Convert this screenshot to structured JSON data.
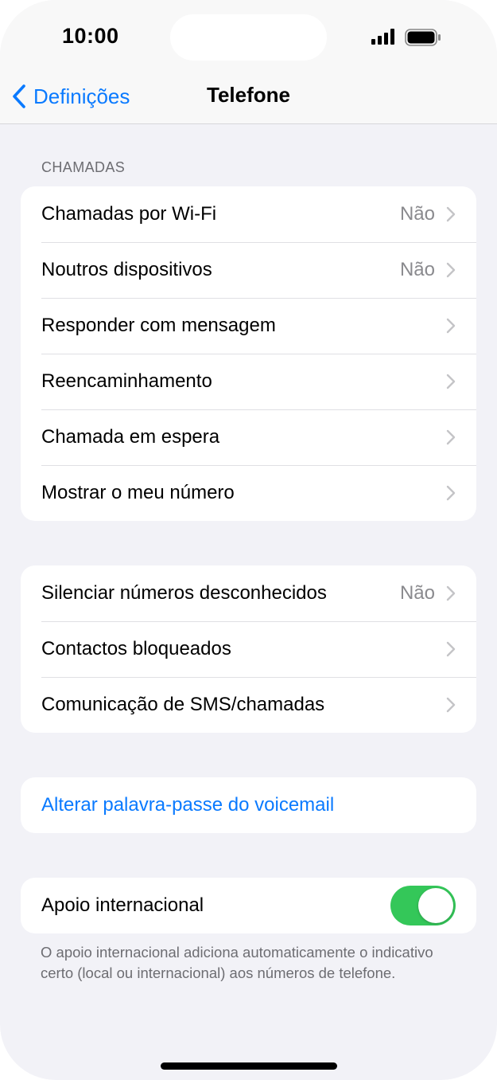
{
  "status": {
    "time": "10:00"
  },
  "nav": {
    "back_label": "Definições",
    "title": "Telefone"
  },
  "calls_section": {
    "header": "CHAMADAS",
    "rows": [
      {
        "label": "Chamadas por Wi-Fi",
        "value": "Não"
      },
      {
        "label": "Noutros dispositivos",
        "value": "Não"
      },
      {
        "label": "Responder com mensagem"
      },
      {
        "label": "Reencaminhamento"
      },
      {
        "label": "Chamada em espera"
      },
      {
        "label": "Mostrar o meu número"
      }
    ]
  },
  "privacy_section": {
    "rows": [
      {
        "label": "Silenciar números desconhecidos",
        "value": "Não"
      },
      {
        "label": "Contactos bloqueados"
      },
      {
        "label": "Comunicação de SMS/chamadas"
      }
    ]
  },
  "voicemail_section": {
    "link_label": "Alterar palavra-passe do voicemail"
  },
  "international_section": {
    "label": "Apoio internacional",
    "toggle_on": true,
    "footer": "O apoio internacional adiciona automaticamente o indicativo certo (local ou internacional) aos números de telefone."
  },
  "colors": {
    "accent": "#0a7aff",
    "toggle_on": "#34c759",
    "background": "#f2f2f7"
  }
}
